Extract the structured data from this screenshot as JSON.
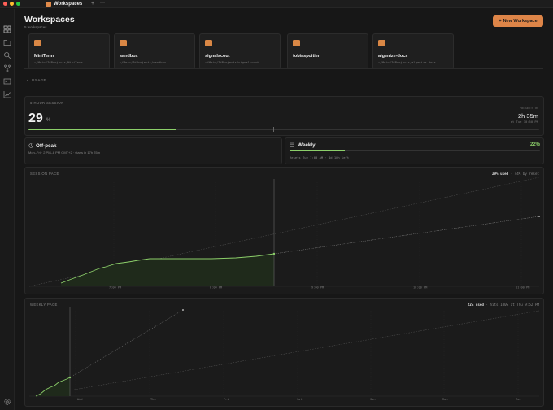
{
  "app": {
    "tab_title": "Workspaces",
    "tab_plus": "+",
    "tab_menu": "···"
  },
  "header": {
    "title": "Workspaces",
    "subtitle": "5 workspaces",
    "new_button": "New Workspace",
    "new_button_icon": "+"
  },
  "sidebar": {
    "items": [
      "grid-icon",
      "folder-icon",
      "search-icon",
      "branch-icon",
      "terminal-icon",
      "chart-icon"
    ],
    "bottom": "settings-icon"
  },
  "workspaces": [
    {
      "name": "MiniTerm",
      "path": "~/Main/ZdProjects/MiniTerm"
    },
    {
      "name": "sandbox",
      "path": "~/Main/ZdProjects/sandbox"
    },
    {
      "name": "signalscout",
      "path": "~/Main/ZdProjects/signalscout"
    },
    {
      "name": "tobiaspoitier",
      "path": ""
    },
    {
      "name": "algenize-docs",
      "path": "~/Main/ZdProjects/algenize-docs"
    }
  ],
  "usage": {
    "section_label": "USAGE",
    "session": {
      "label": "5-HOUR SESSION",
      "percent": 29,
      "percent_text": "29",
      "percent_sign": "%",
      "resets_label": "RESETS IN",
      "resets_value": "2h 35m",
      "resets_at": "at Tue 10:50 PM"
    },
    "offpeak": {
      "title": "Off-peak",
      "subtitle": "Mon–Fri · 2 PM–8 PM GMT+2 · starts in 17h 25m"
    },
    "weekly": {
      "title": "Weekly",
      "percent": 22,
      "percent_text": "22%",
      "subtitle": "Resets Tue 7:00 AM · 4d 10h left"
    }
  },
  "session_pace": {
    "label": "SESSION PACE",
    "used_text": "29% used",
    "side_text": " · 44% by reset",
    "x_ticks": [
      "7:00 PM",
      "8:00 PM",
      "9:00 PM",
      "10:00 PM",
      "11:00 PM"
    ]
  },
  "weekly_pace": {
    "label": "WEEKLY PACE",
    "used_text": "22% used",
    "side_text": " · hits 100% at Thu 9:52 PM",
    "x_ticks": [
      "Wed",
      "Thu",
      "Fri",
      "Sat",
      "Sun",
      "Mon",
      "Tue"
    ]
  },
  "colors": {
    "accent": "#de8548",
    "green": "#8ccf6a",
    "bg": "#171717"
  }
}
